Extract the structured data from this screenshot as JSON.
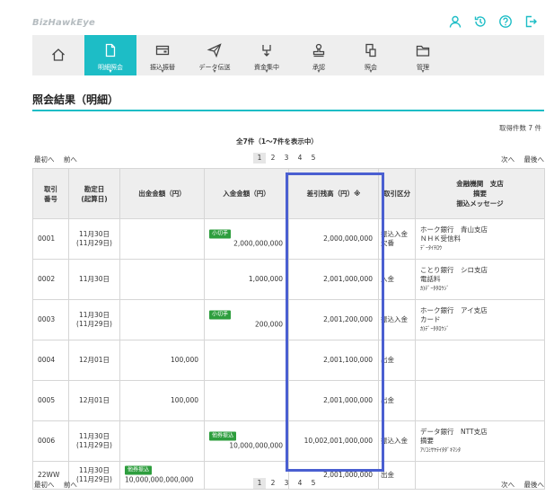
{
  "app": {
    "logo": "BizHawkEye"
  },
  "top_icons": [
    "user-icon",
    "history-icon",
    "help-icon",
    "logout-icon"
  ],
  "nav": {
    "items": [
      {
        "label": "",
        "icon": "home-icon"
      },
      {
        "label": "明細照会",
        "icon": "document-icon",
        "active": true
      },
      {
        "label": "振込振替",
        "icon": "card-icon"
      },
      {
        "label": "データ伝送",
        "icon": "send-icon"
      },
      {
        "label": "資金集中",
        "icon": "collect-icon"
      },
      {
        "label": "承認",
        "icon": "stamp-icon"
      },
      {
        "label": "照会",
        "icon": "inquiry-icon"
      },
      {
        "label": "管理",
        "icon": "folder-icon"
      }
    ]
  },
  "page": {
    "title": "照会結果（明細）",
    "count_label": "取得件数 7 件",
    "summary": "全7件（1〜7件を表示中）"
  },
  "pager": {
    "first": "最初へ",
    "prev": "前へ",
    "next": "次へ",
    "last": "最後へ",
    "pages": [
      "1",
      "2",
      "3",
      "4",
      "5"
    ],
    "current": "1"
  },
  "table": {
    "headers": {
      "no": [
        "取引",
        "番号"
      ],
      "date": [
        "勘定日",
        "(起算日)"
      ],
      "out": "出金金額（円）",
      "in": "入金金額（円）",
      "balance": "差引残高（円）※",
      "kind": "取引区分",
      "info": [
        "金融機関　支店",
        "摘要",
        "振込メッセージ"
      ]
    },
    "rows": [
      {
        "no": "0001",
        "date1": "11月30日",
        "date2": "(11月29日)",
        "out_tag": "",
        "out": "",
        "in_tag": "小切手",
        "in": "2,000,000,000",
        "balance": "2,000,000,000",
        "kind": "振込入金\n欠番",
        "info": [
          "ホーク銀行　青山支店",
          "ＮＨＫ受信料",
          "ﾃﾞｰﾀｲﾁﾛｳ"
        ]
      },
      {
        "no": "0002",
        "date1": "11月30日",
        "date2": "",
        "out_tag": "",
        "out": "",
        "in_tag": "",
        "in": "1,000,000",
        "balance": "2,001,000,000",
        "kind": "入金",
        "info": [
          "ことり銀行　シロ支店",
          "電話料",
          "ｶ)ﾃﾞｰﾀﾀﾛｳｼﾞ"
        ]
      },
      {
        "no": "0003",
        "date1": "11月30日",
        "date2": "(11月29日)",
        "out_tag": "",
        "out": "",
        "in_tag": "小切手",
        "in": "200,000",
        "balance": "2,001,200,000",
        "kind": "振込入金",
        "info": [
          "ホーク銀行　アイ支店",
          "カード",
          "ｶ)ﾃﾞｰﾀﾀﾛｳｼﾞ"
        ]
      },
      {
        "no": "0004",
        "date1": "12月01日",
        "date2": "",
        "out_tag": "",
        "out": "100,000",
        "in_tag": "",
        "in": "",
        "balance": "2,001,100,000",
        "kind": "出金",
        "info": [
          "",
          "",
          ""
        ]
      },
      {
        "no": "0005",
        "date1": "12月01日",
        "date2": "",
        "out_tag": "",
        "out": "100,000",
        "in_tag": "",
        "in": "",
        "balance": "2,001,000,000",
        "kind": "出金",
        "info": [
          "",
          "",
          ""
        ]
      },
      {
        "no": "0006",
        "date1": "11月30日",
        "date2": "(11月29日)",
        "out_tag": "",
        "out": "",
        "in_tag": "他券振込",
        "in": "10,000,000,000",
        "balance": "10,002,001,000,000",
        "kind": "振込入金",
        "info": [
          "データ銀行　NTT支店",
          "摘要",
          "ｱﾘｺﾐｻﾔﾃｲﾀﾀﾞｷﾏｼﾀ"
        ]
      },
      {
        "no": "22WW",
        "date1": "11月30日",
        "date2": "(11月29日)",
        "out_tag": "他券振込",
        "out": "10,000,000,000,000",
        "in_tag": "",
        "in": "",
        "balance": "2,001,000,000",
        "kind": "出金",
        "info": [
          "",
          "",
          ""
        ]
      }
    ]
  },
  "colors": {
    "accent": "#1dbdc6",
    "tag_green": "#2e9e3e",
    "highlight": "#4a5fd1",
    "header_bg": "#eeeeee"
  }
}
